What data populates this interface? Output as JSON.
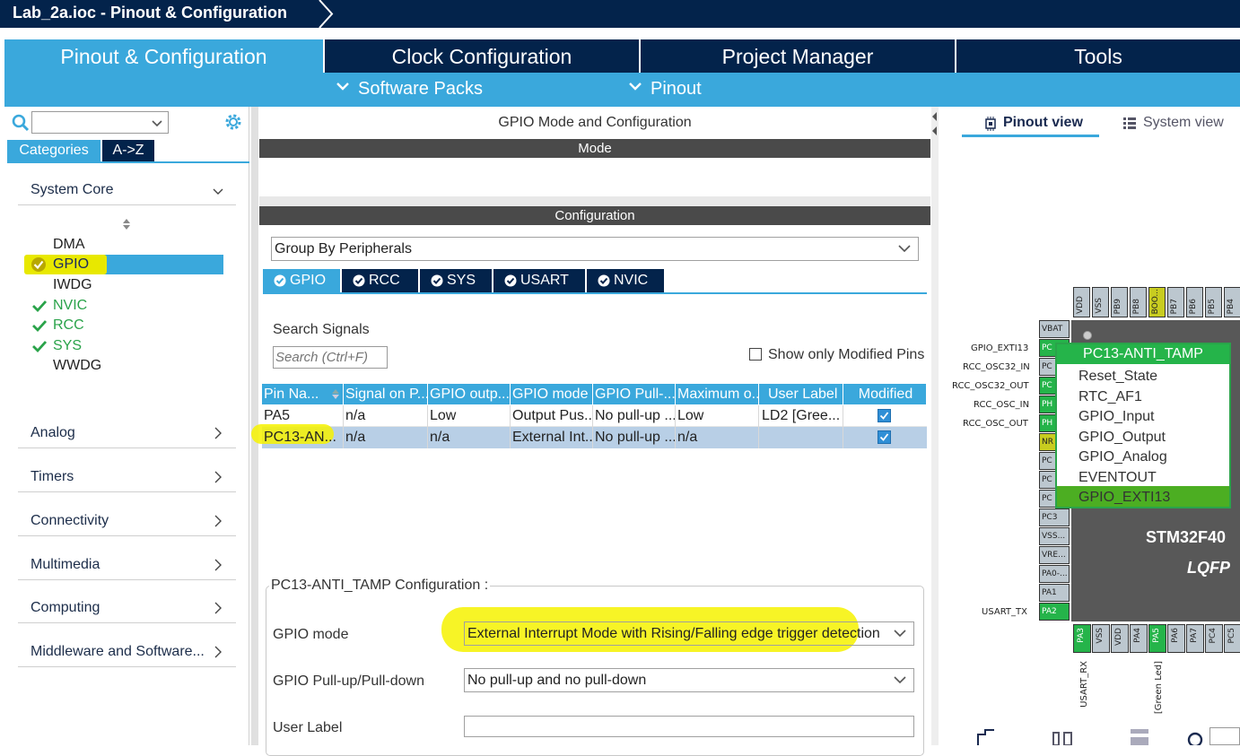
{
  "window": {
    "title": "Lab_2a.ioc - Pinout & Configuration"
  },
  "main_tabs": [
    {
      "label": "Pinout & Configuration",
      "active": true
    },
    {
      "label": "Clock Configuration",
      "active": false
    },
    {
      "label": "Project Manager",
      "active": false
    },
    {
      "label": "Tools",
      "active": false
    }
  ],
  "sub_menu": [
    {
      "label": "Software Packs"
    },
    {
      "label": "Pinout"
    }
  ],
  "left_panel": {
    "search": {
      "value": ""
    },
    "tabs": [
      {
        "label": "Categories",
        "active": true
      },
      {
        "label": "A->Z",
        "active": false
      }
    ],
    "system_core": {
      "label": "System Core",
      "items": [
        {
          "label": "DMA",
          "checked": false,
          "selected": false
        },
        {
          "label": "GPIO",
          "checked": true,
          "selected": true
        },
        {
          "label": "IWDG",
          "checked": false,
          "selected": false
        },
        {
          "label": "NVIC",
          "checked": true,
          "selected": false
        },
        {
          "label": "RCC",
          "checked": true,
          "selected": false
        },
        {
          "label": "SYS",
          "checked": true,
          "selected": false
        },
        {
          "label": "WWDG",
          "checked": false,
          "selected": false
        }
      ]
    },
    "categories": [
      {
        "label": "Analog"
      },
      {
        "label": "Timers"
      },
      {
        "label": "Connectivity"
      },
      {
        "label": "Multimedia"
      },
      {
        "label": "Computing"
      },
      {
        "label": "Middleware and Software..."
      }
    ]
  },
  "center": {
    "header": "GPIO Mode and Configuration",
    "mode_bar": "Mode",
    "config_bar": "Configuration",
    "group_by": "Group By Peripherals",
    "peripheral_tabs": [
      {
        "label": "GPIO",
        "active": true
      },
      {
        "label": "RCC",
        "active": false
      },
      {
        "label": "SYS",
        "active": false
      },
      {
        "label": "USART",
        "active": false
      },
      {
        "label": "NVIC",
        "active": false
      }
    ],
    "search_signals": {
      "label": "Search Signals",
      "placeholder": "Search (Ctrl+F)"
    },
    "show_modified": {
      "label": "Show only Modified Pins",
      "checked": false
    },
    "table": {
      "columns": [
        "Pin Na...",
        "Signal on P...",
        "GPIO outp...",
        "GPIO mode",
        "GPIO Pull-...",
        "Maximum o...",
        "User Label",
        "Modified"
      ],
      "rows": [
        {
          "cells": [
            "PA5",
            "n/a",
            "Low",
            "Output Pus...",
            "No pull-up ...",
            "Low",
            "LD2 [Gree..."
          ],
          "modified": true,
          "selected": false
        },
        {
          "cells": [
            "PC13-AN...",
            "n/a",
            "n/a",
            "External Int...",
            "No pull-up ...",
            "n/a",
            ""
          ],
          "modified": true,
          "selected": true
        }
      ]
    },
    "pin_config": {
      "title": "PC13-ANTI_TAMP Configuration :",
      "gpio_mode": {
        "label": "GPIO mode",
        "value": "External Interrupt Mode with Rising/Falling edge trigger detection"
      },
      "gpio_pull": {
        "label": "GPIO Pull-up/Pull-down",
        "value": "No pull-up and no pull-down"
      },
      "user_label": {
        "label": "User Label",
        "value": ""
      }
    }
  },
  "right": {
    "view_tabs": [
      {
        "label": "Pinout view",
        "active": true
      },
      {
        "label": "System view",
        "active": false
      }
    ],
    "chip_name": "STM32F40",
    "chip_package": "LQFP",
    "top_pins": [
      "VDD",
      "VSS",
      "PB9",
      "PB8",
      "BOO...",
      "PB7",
      "PB6",
      "PB5",
      "PB4"
    ],
    "left_pins": [
      {
        "label": "VBAT",
        "ext": ""
      },
      {
        "label": "PC",
        "ext": "GPIO_EXTI13"
      },
      {
        "label": "PC",
        "ext": "RCC_OSC32_IN"
      },
      {
        "label": "PC",
        "ext": "RCC_OSC32_OUT"
      },
      {
        "label": "PH",
        "ext": "RCC_OSC_IN"
      },
      {
        "label": "PH",
        "ext": "RCC_OSC_OUT"
      },
      {
        "label": "NR",
        "ext": ""
      },
      {
        "label": "PC",
        "ext": ""
      },
      {
        "label": "PC",
        "ext": ""
      },
      {
        "label": "PC",
        "ext": ""
      },
      {
        "label": "PC3",
        "ext": ""
      },
      {
        "label": "VSS...",
        "ext": ""
      },
      {
        "label": "VRE...",
        "ext": ""
      },
      {
        "label": "PA0-...",
        "ext": ""
      },
      {
        "label": "PA1",
        "ext": ""
      },
      {
        "label": "PA2",
        "ext": "USART_TX"
      }
    ],
    "bottom_pins": [
      "PA3",
      "VSS",
      "VDD",
      "PA4",
      "PA5",
      "PA6",
      "PA7",
      "PC4",
      "PC5"
    ],
    "bottom_ext": [
      {
        "label": "USART_RX"
      },
      {
        "label": "[Green Led]"
      }
    ],
    "popup": {
      "title": "PC13-ANTI_TAMP",
      "items": [
        "Reset_State",
        "RTC_AF1",
        "GPIO_Input",
        "GPIO_Output",
        "GPIO_Analog",
        "EVENTOUT",
        "GPIO_EXTI13"
      ],
      "selected": "GPIO_EXTI13"
    }
  },
  "colors": {
    "navy": "#03234b",
    "accent": "#3aa8dc",
    "pin_green": "#25b44a",
    "check_green": "#2aa34a",
    "highlight": "#f6f200"
  }
}
